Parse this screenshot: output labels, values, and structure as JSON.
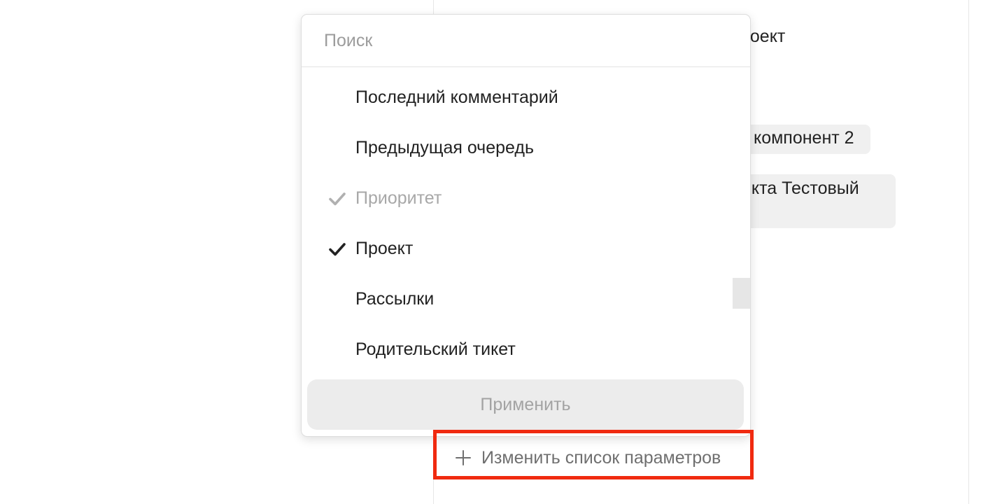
{
  "background": {
    "project_fragment": "роект",
    "component_fragment": "компонент 2",
    "project_block_fragment": "екта Тестовый"
  },
  "dropdown": {
    "search_placeholder": "Поиск",
    "items": [
      {
        "label": "Последний комментарий",
        "checked": false,
        "disabled": false
      },
      {
        "label": "Предыдущая очередь",
        "checked": false,
        "disabled": false
      },
      {
        "label": "Приоритет",
        "checked": true,
        "disabled": true
      },
      {
        "label": "Проект",
        "checked": true,
        "disabled": false
      },
      {
        "label": "Рассылки",
        "checked": false,
        "disabled": false
      },
      {
        "label": "Родительский тикет",
        "checked": false,
        "disabled": false
      }
    ],
    "apply_label": "Применить"
  },
  "change_params": {
    "label": "Изменить список параметров",
    "icon": "plus-icon"
  },
  "colors": {
    "highlight": "#f02a10",
    "check_active": "#222222",
    "check_disabled": "#b0b0b0",
    "button_bg": "#ececec"
  }
}
